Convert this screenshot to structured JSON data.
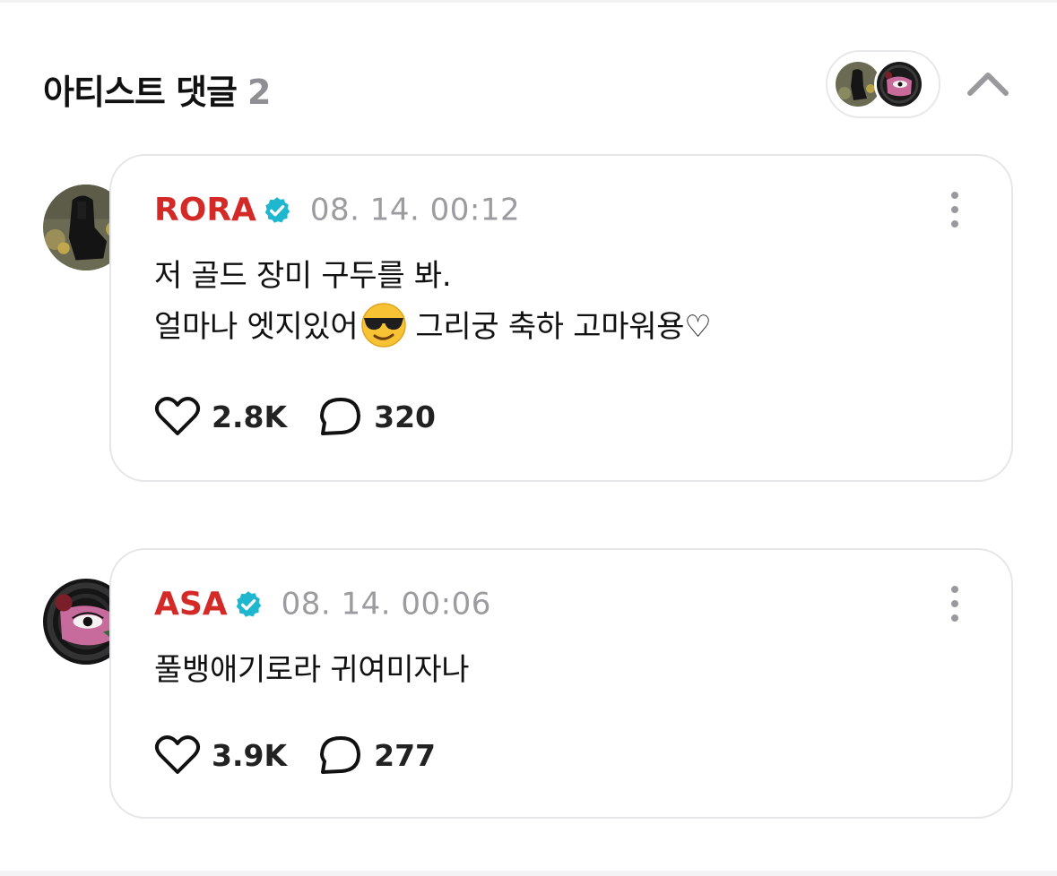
{
  "header": {
    "title": "아티스트 댓글",
    "count": "2"
  },
  "comments": [
    {
      "author": "RORA",
      "timestamp": "08. 14. 00:12",
      "lines": [
        "저 골드 장미 구두를 봐.",
        "얼마나 엣지있어",
        "그리궁 축하 고마워용♡"
      ],
      "emoji_icon": "sunglasses-emoji-icon",
      "likes": "2.8K",
      "replies": "320"
    },
    {
      "author": "ASA",
      "timestamp": "08. 14. 00:06",
      "lines": [
        "풀뱅애기로라 귀여미자나"
      ],
      "likes": "3.9K",
      "replies": "277"
    }
  ],
  "colors": {
    "author": "#d42a27",
    "verified": "#1fb7cf",
    "muted": "#9b9ba0",
    "border": "#e6e6ea"
  },
  "icons": [
    "chevron-up-icon",
    "verified-badge-icon",
    "more-vertical-icon",
    "heart-icon",
    "comment-bubble-icon"
  ]
}
